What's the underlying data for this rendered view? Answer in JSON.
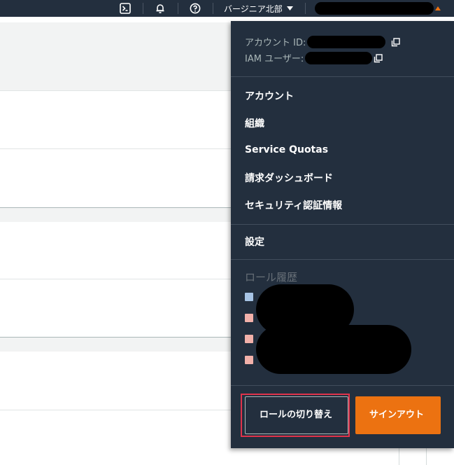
{
  "topbar": {
    "icons": [
      "cloudshell-icon",
      "bell-icon",
      "help-icon"
    ],
    "region_label": "バージニア北部",
    "accent_color": "#ec7211",
    "bar_color": "#232f3e"
  },
  "account_menu": {
    "account_id_label": "アカウント ID:",
    "iam_user_label": "IAM ユーザー:",
    "items": [
      {
        "label": "アカウント"
      },
      {
        "label": "組織"
      },
      {
        "label": "Service Quotas"
      },
      {
        "label": "請求ダッシュボード"
      },
      {
        "label": "セキュリティ認証情報"
      }
    ],
    "settings_label": "設定",
    "role_history_label": "ロール履歴",
    "role_history_colors": [
      "#a7c4e5",
      "#f2b1aa",
      "#f2b1aa",
      "#f2b1aa"
    ],
    "switch_role_label": "ロールの切り替え",
    "sign_out_label": "サインアウト"
  }
}
